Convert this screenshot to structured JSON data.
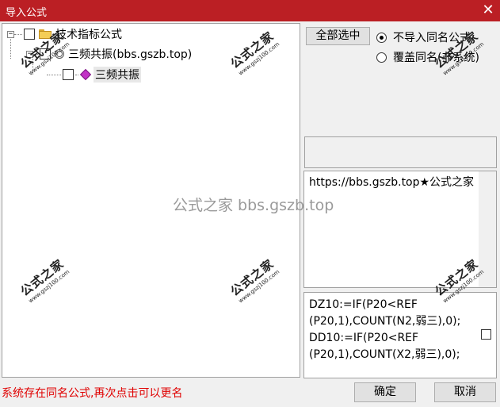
{
  "window": {
    "title": "导入公式",
    "close_symbol": "✕"
  },
  "tree": {
    "root": {
      "label": "技术指标公式",
      "expander": "−",
      "checked": false
    },
    "group": {
      "label": "三频共振(bbs.gszb.top)",
      "expander": "−",
      "checked": false
    },
    "leaf": {
      "label": "三频共振",
      "checked": false,
      "selected": true
    }
  },
  "options": {
    "select_all_label": "全部选中",
    "radio_skip_label": "不导入同名公式",
    "radio_overwrite_label": "覆盖同名(非系统)",
    "selected_radio": "skip"
  },
  "info_text": "https://bbs.gszb.top★公式之家",
  "code_lines": [
    "DZ10:=IF(P20<REF",
    "(P20,1),COUNT(N2,弱三),0);",
    "DD10:=IF(P20<REF",
    "(P20,1),COUNT(X2,弱三),0);"
  ],
  "status_message": "系统存在同名公式,再次点击可以更名",
  "buttons": {
    "ok_label": "确定",
    "cancel_label": "取消"
  },
  "watermark": {
    "center_text": "公式之家 bbs.gszb.top",
    "stamp_text": "公式之家",
    "stamp_url": "www.gszj100.com"
  }
}
